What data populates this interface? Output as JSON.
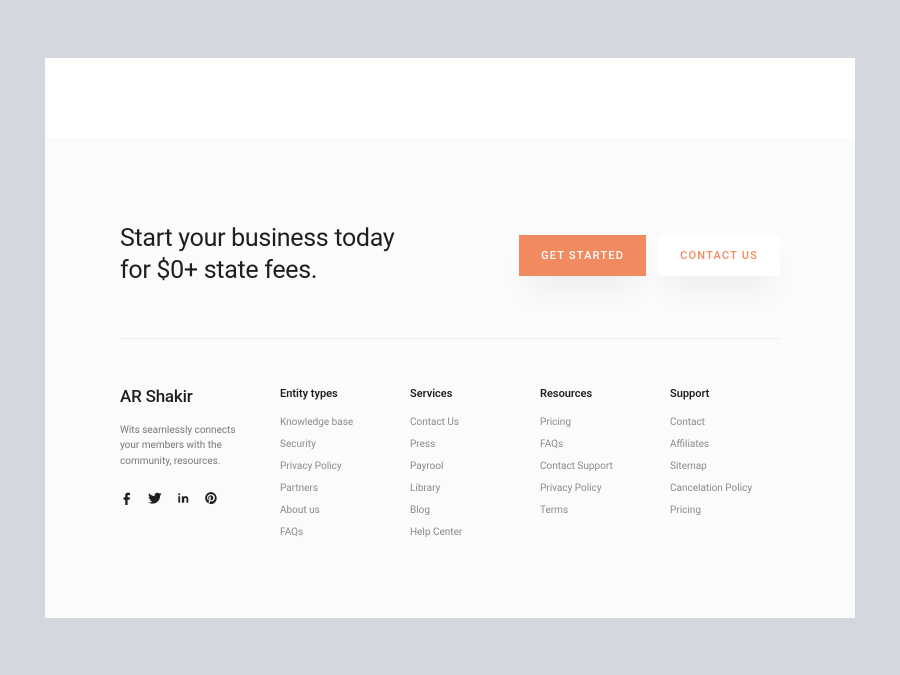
{
  "cta": {
    "heading_line1": "Start your business today",
    "heading_line2": "for $0+ state fees.",
    "primary_button": "GET STARTED",
    "secondary_button": "CONTACT US"
  },
  "brand": {
    "name": "AR Shakir",
    "description": "Wits seamlessly connects your members with the community, resources."
  },
  "columns": [
    {
      "heading": "Entity types",
      "links": [
        "Knowledge base",
        "Security",
        "Privacy Policy",
        "Partners",
        "About us",
        "FAQs"
      ]
    },
    {
      "heading": "Services",
      "links": [
        "Contact Us",
        "Press",
        "Payrool",
        "Library",
        "Blog",
        "Help Center"
      ]
    },
    {
      "heading": "Resources",
      "links": [
        "Pricing",
        "FAQs",
        "Contact Support",
        "Privacy Policy",
        "Terms"
      ]
    },
    {
      "heading": "Support",
      "links": [
        "Contact",
        "Affiliates",
        "Sitemap",
        "Cancelation Policy",
        "Pricing"
      ]
    }
  ]
}
